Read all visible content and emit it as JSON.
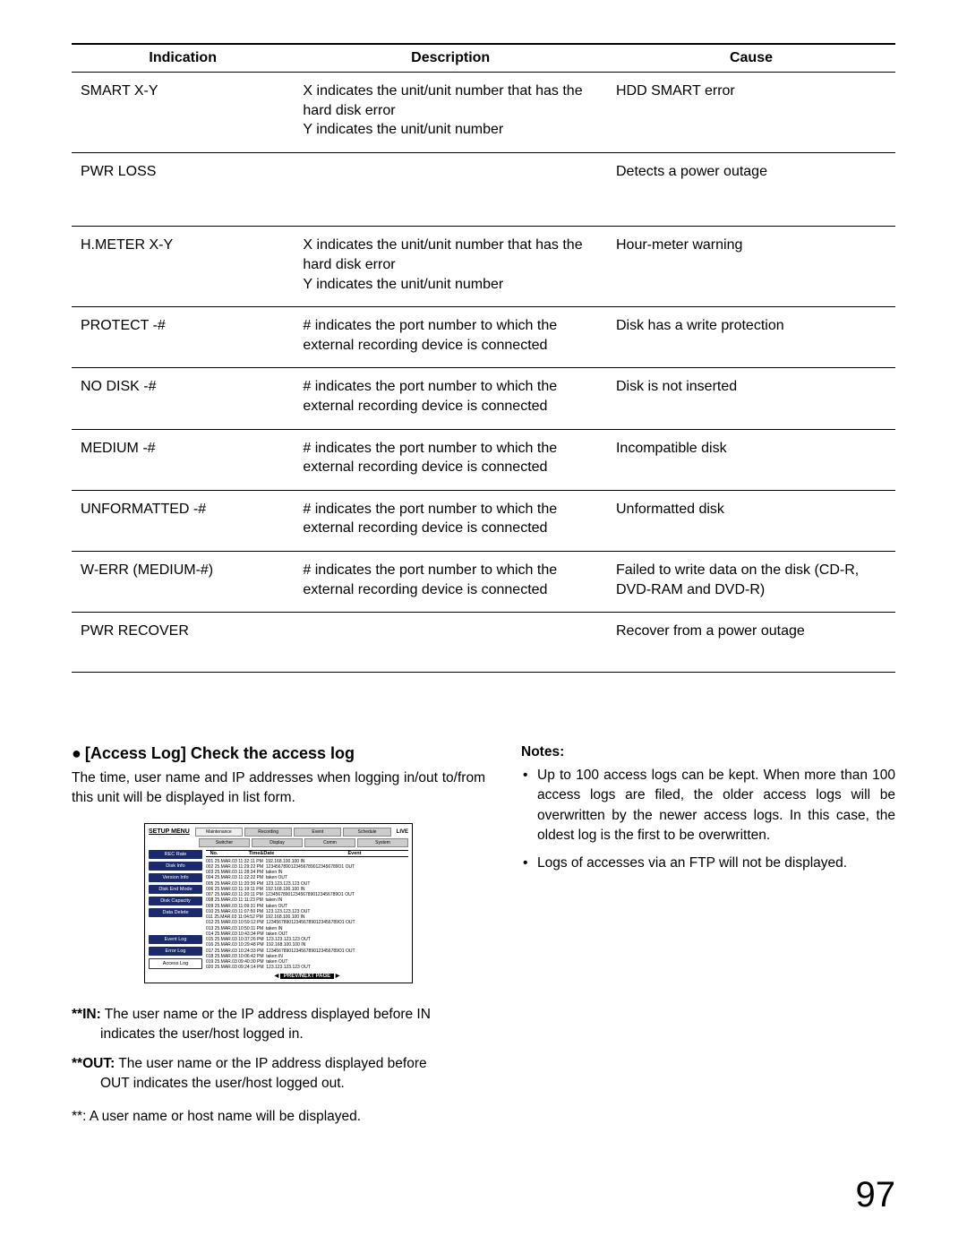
{
  "table": {
    "headers": {
      "c1": "Indication",
      "c2": "Description",
      "c3": "Cause"
    },
    "rows": [
      {
        "ind": "SMART X-Y",
        "desc": "X indicates the unit/unit number that has the hard disk error\nY indicates the unit/unit number",
        "cause": "HDD SMART error"
      },
      {
        "ind": "PWR LOSS",
        "desc": "",
        "cause": "Detects a power outage"
      },
      {
        "ind": "H.METER X-Y",
        "desc": "X indicates the unit/unit number that has the hard disk error\nY indicates the unit/unit number",
        "cause": "Hour-meter warning"
      },
      {
        "ind": "PROTECT -#",
        "desc": "# indicates the port number to which the external recording device is connected",
        "cause": "Disk has a write protection"
      },
      {
        "ind": "NO DISK -#",
        "desc": "# indicates the port number to which the external recording device is connected",
        "cause": "Disk is not inserted"
      },
      {
        "ind": "MEDIUM -#",
        "desc": "# indicates the port number to which the external recording device is connected",
        "cause": "Incompatible disk"
      },
      {
        "ind": "UNFORMATTED -#",
        "desc": "# indicates the port number to which the external recording device is connected",
        "cause": "Unformatted disk"
      },
      {
        "ind": "W-ERR (MEDIUM-#)",
        "desc": "# indicates the port number to which the external recording device is connected",
        "cause": "Failed to write data on the disk (CD-R, DVD-RAM and DVD-R)"
      },
      {
        "ind": "PWR RECOVER",
        "desc": "",
        "cause": "Recover from a power outage"
      }
    ]
  },
  "section_title": "[Access Log] Check the access log",
  "section_lead": "The time, user name and IP addresses when logging in/out to/from this unit will be displayed in list form.",
  "screenshot": {
    "title": "SETUP MENU",
    "tabs1": [
      "Maintenance",
      "Recording",
      "Event",
      "Schedule"
    ],
    "tabs2": [
      "Switcher",
      "Display",
      "Comm",
      "System"
    ],
    "live": "LIVE",
    "side": [
      "REC Rate",
      "Disk Info",
      "Version Info",
      "Disk End Mode",
      "Disk Capacity",
      "Data Delete"
    ],
    "side_gap": "",
    "side2": [
      "Event Log",
      "Error Log"
    ],
    "side_outline": "Access Log",
    "cols": {
      "c1": "No.",
      "c2": "Time&Date",
      "c3": "Event"
    },
    "log_lines": "001 25.MAR.03 11:32:11 PM  192.168.100.100 IN\n002 25.MAR.03 11:29:22 PM  12345678901234567890123456789O1 OUT\n003 25.MAR.03 11:28:34 PM  taken IN\n004 25.MAR.03 11:22:22 PM  taken OUT\n005 25.MAR.03 11:20:36 PM  123.123.123.123 OUT\n006 25.MAR.03 11:19:11 PM  192.168.100.100 IN\n007 25.MAR.03 11:20:11 PM  12345678901234567890123456789O1 OUT\n008 25.MAR.03 11:11:23 PM  taken IN\n009 25.MAR.03 11:09:31 PM  taken OUT\n010 25.MAR.03 11:07:50 PM  123.123.123.123 OUT\n011 25.MAR.03 11:04:52 PM  192.168.100.100 IN\n012 25.MAR.03 10:59:12 PM  12345678901234567890123456789O1 OUT\n013 25.MAR.03 10:50:11 PM  taken IN\n014 25.MAR.03 10:43:34 PM  taken OUT\n015 25.MAR.03 10:37:26 PM  123.123.123.123 OUT\n016 25.MAR.03 10:29:48 PM  192.168.100.100 IN\n017 25.MAR.03 10:24:33 PM  12345678901234567890123456789O1 OUT\n018 25.MAR.03 10:06:42 PM  taken IN\n019 25.MAR.03 09:40:30 PM  taken OUT\n020 25.MAR.03 09:24:14 PM  123.123.123.123 OUT",
    "footer": {
      "prev": "◀",
      "label": "PREV/NEXT PAGE",
      "next": "▶"
    }
  },
  "defs": {
    "in_label": "**IN:",
    "in_text_a": " The user name or the IP address displayed before IN ",
    "in_text_b": "indicates the user/host logged in.",
    "out_label": "**OUT:",
    "out_text_a": " The user name or the IP address displayed before ",
    "out_text_b": "OUT indicates the user/host logged out.",
    "footnote": "**: A user name or host name will be displayed."
  },
  "notes": {
    "label": "Notes:",
    "items": [
      "Up to 100 access logs can be kept. When more than 100 access logs are filed, the older access logs will be overwritten by the newer access logs. In this case, the oldest log is the first to be overwritten.",
      "Logs of accesses via an FTP will not be displayed."
    ]
  },
  "page_number": "97"
}
